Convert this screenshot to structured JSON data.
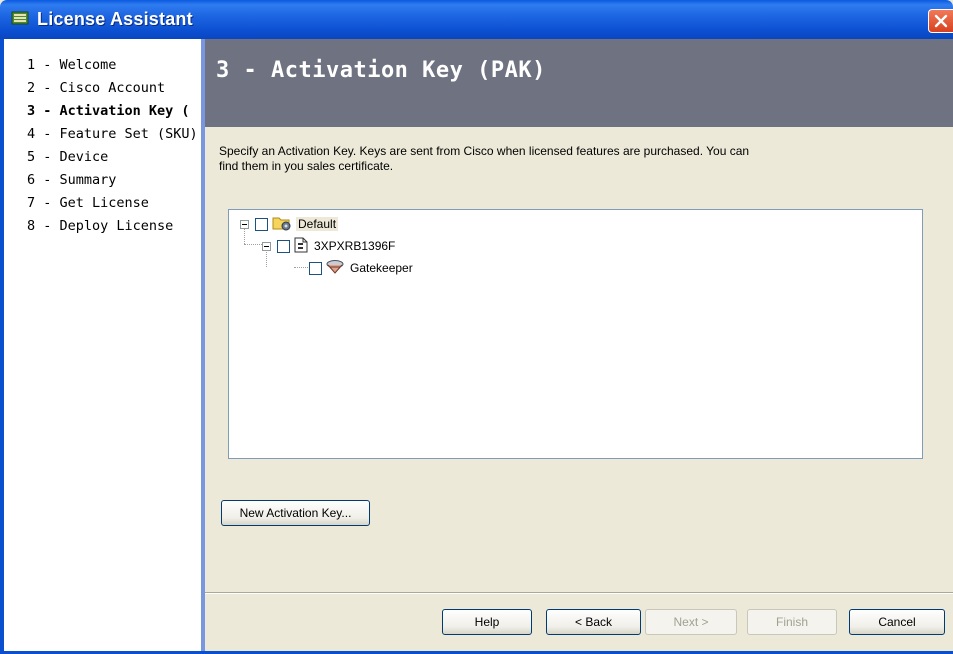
{
  "window": {
    "title": "License Assistant"
  },
  "steps": [
    {
      "label": "1 - Welcome",
      "active": false
    },
    {
      "label": "2 - Cisco Account",
      "active": false
    },
    {
      "label": "3 - Activation Key (",
      "active": true
    },
    {
      "label": "4 - Feature Set (SKU)",
      "active": false
    },
    {
      "label": "5 - Device",
      "active": false
    },
    {
      "label": "6 - Summary",
      "active": false
    },
    {
      "label": "7 - Get License",
      "active": false
    },
    {
      "label": "8 - Deploy License",
      "active": false
    }
  ],
  "header": {
    "title": "3 - Activation Key (PAK)"
  },
  "description": "Specify an Activation Key. Keys are sent from Cisco when licensed features are purchased. You can find them in you sales certificate.",
  "tree": {
    "nodes": [
      {
        "label": "Default",
        "icon": "folder-icon",
        "checked": false,
        "expanded": true
      },
      {
        "label": "3XPXRB1396F",
        "icon": "document-icon",
        "checked": false,
        "expanded": true
      },
      {
        "label": "Gatekeeper",
        "icon": "gatekeeper-icon",
        "checked": false
      }
    ]
  },
  "buttons": {
    "new_key": "New Activation Key...",
    "help": "Help",
    "back": "< Back",
    "next": "Next >",
    "finish": "Finish",
    "cancel": "Cancel"
  },
  "colors": {
    "titlebar": "#0b4fd0",
    "header": "#6f7281",
    "panel": "#ece9d8"
  }
}
